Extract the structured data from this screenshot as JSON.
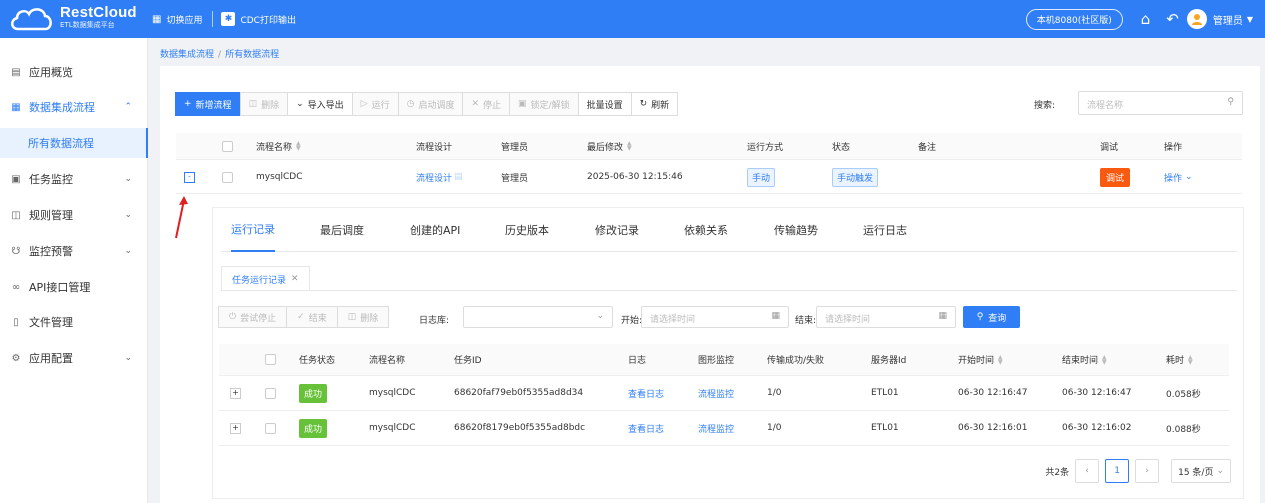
{
  "brand": {
    "name": "RestCloud",
    "subtitle": "ETL数据集成平台"
  },
  "topbar": {
    "switch_app": "切换应用",
    "current_app": "CDC打印输出",
    "environment": "本机8080(社区版)",
    "user": "管理员"
  },
  "sidebar": {
    "items": [
      {
        "label": "应用概览",
        "icon": "dashboard-icon"
      },
      {
        "label": "数据集成流程",
        "icon": "grid-icon",
        "expanded": true
      },
      {
        "label": "任务监控",
        "icon": "monitor-icon"
      },
      {
        "label": "规则管理",
        "icon": "rules-icon"
      },
      {
        "label": "监控预警",
        "icon": "alarm-icon"
      },
      {
        "label": "API接口管理",
        "icon": "link-icon"
      },
      {
        "label": "文件管理",
        "icon": "file-icon"
      },
      {
        "label": "应用配置",
        "icon": "settings-icon"
      }
    ],
    "active_sub": "所有数据流程"
  },
  "breadcrumb": {
    "parent": "数据集成流程",
    "current": "所有数据流程"
  },
  "toolbar": {
    "new": "新增流程",
    "delete": "删除",
    "import_export": "导入导出",
    "run": "运行",
    "schedule": "启动调度",
    "stop": "停止",
    "lock": "锁定/解锁",
    "batch": "批量设置",
    "refresh": "刷新"
  },
  "search": {
    "label": "搜索:",
    "placeholder": "流程名称"
  },
  "grid": {
    "columns": [
      "流程名称",
      "流程设计",
      "管理员",
      "最后修改",
      "运行方式",
      "状态",
      "备注",
      "调试",
      "操作"
    ],
    "row": {
      "name": "mysqlCDC",
      "design": "流程设计",
      "admin": "管理员",
      "modified": "2025-06-30 12:15:46",
      "run_mode": "手动",
      "status": "手动触发",
      "note": "",
      "debug": "调试",
      "action": "操作"
    }
  },
  "detail": {
    "tabs": [
      "运行记录",
      "最后调度",
      "创建的API",
      "历史版本",
      "修改记录",
      "依赖关系",
      "传输趋势",
      "运行日志"
    ],
    "subtab": "任务运行记录",
    "filters": {
      "try_stop": "尝试停止",
      "finish": "结束",
      "delete": "删除",
      "log_label": "日志库:",
      "start_label": "开始:",
      "start_placeholder": "请选择时间",
      "end_label": "结束:",
      "end_placeholder": "请选择时间",
      "query": "查询"
    },
    "columns": [
      "任务状态",
      "流程名称",
      "任务ID",
      "日志",
      "图形监控",
      "传输成功/失败",
      "服务器Id",
      "开始时间",
      "结束时间",
      "耗时"
    ],
    "rows": [
      {
        "status": "成功",
        "name": "mysqlCDC",
        "id": "68620faf79eb0f5355ad8d34",
        "log": "查看日志",
        "monitor": "流程监控",
        "transfer": "1/0",
        "server": "ETL01",
        "start": "06-30 12:16:47",
        "end": "06-30 12:16:47",
        "duration": "0.058秒"
      },
      {
        "status": "成功",
        "name": "mysqlCDC",
        "id": "68620f8179eb0f5355ad8bdc",
        "log": "查看日志",
        "monitor": "流程监控",
        "transfer": "1/0",
        "server": "ETL01",
        "start": "06-30 12:16:01",
        "end": "06-30 12:16:02",
        "duration": "0.088秒"
      }
    ],
    "pager": {
      "total": "共2条",
      "page": "1",
      "page_size": "15 条/页"
    }
  },
  "colors": {
    "primary": "#2f7ef5",
    "success": "#67c23a",
    "debug": "#fa5a0f",
    "annotation": "#e02020"
  }
}
